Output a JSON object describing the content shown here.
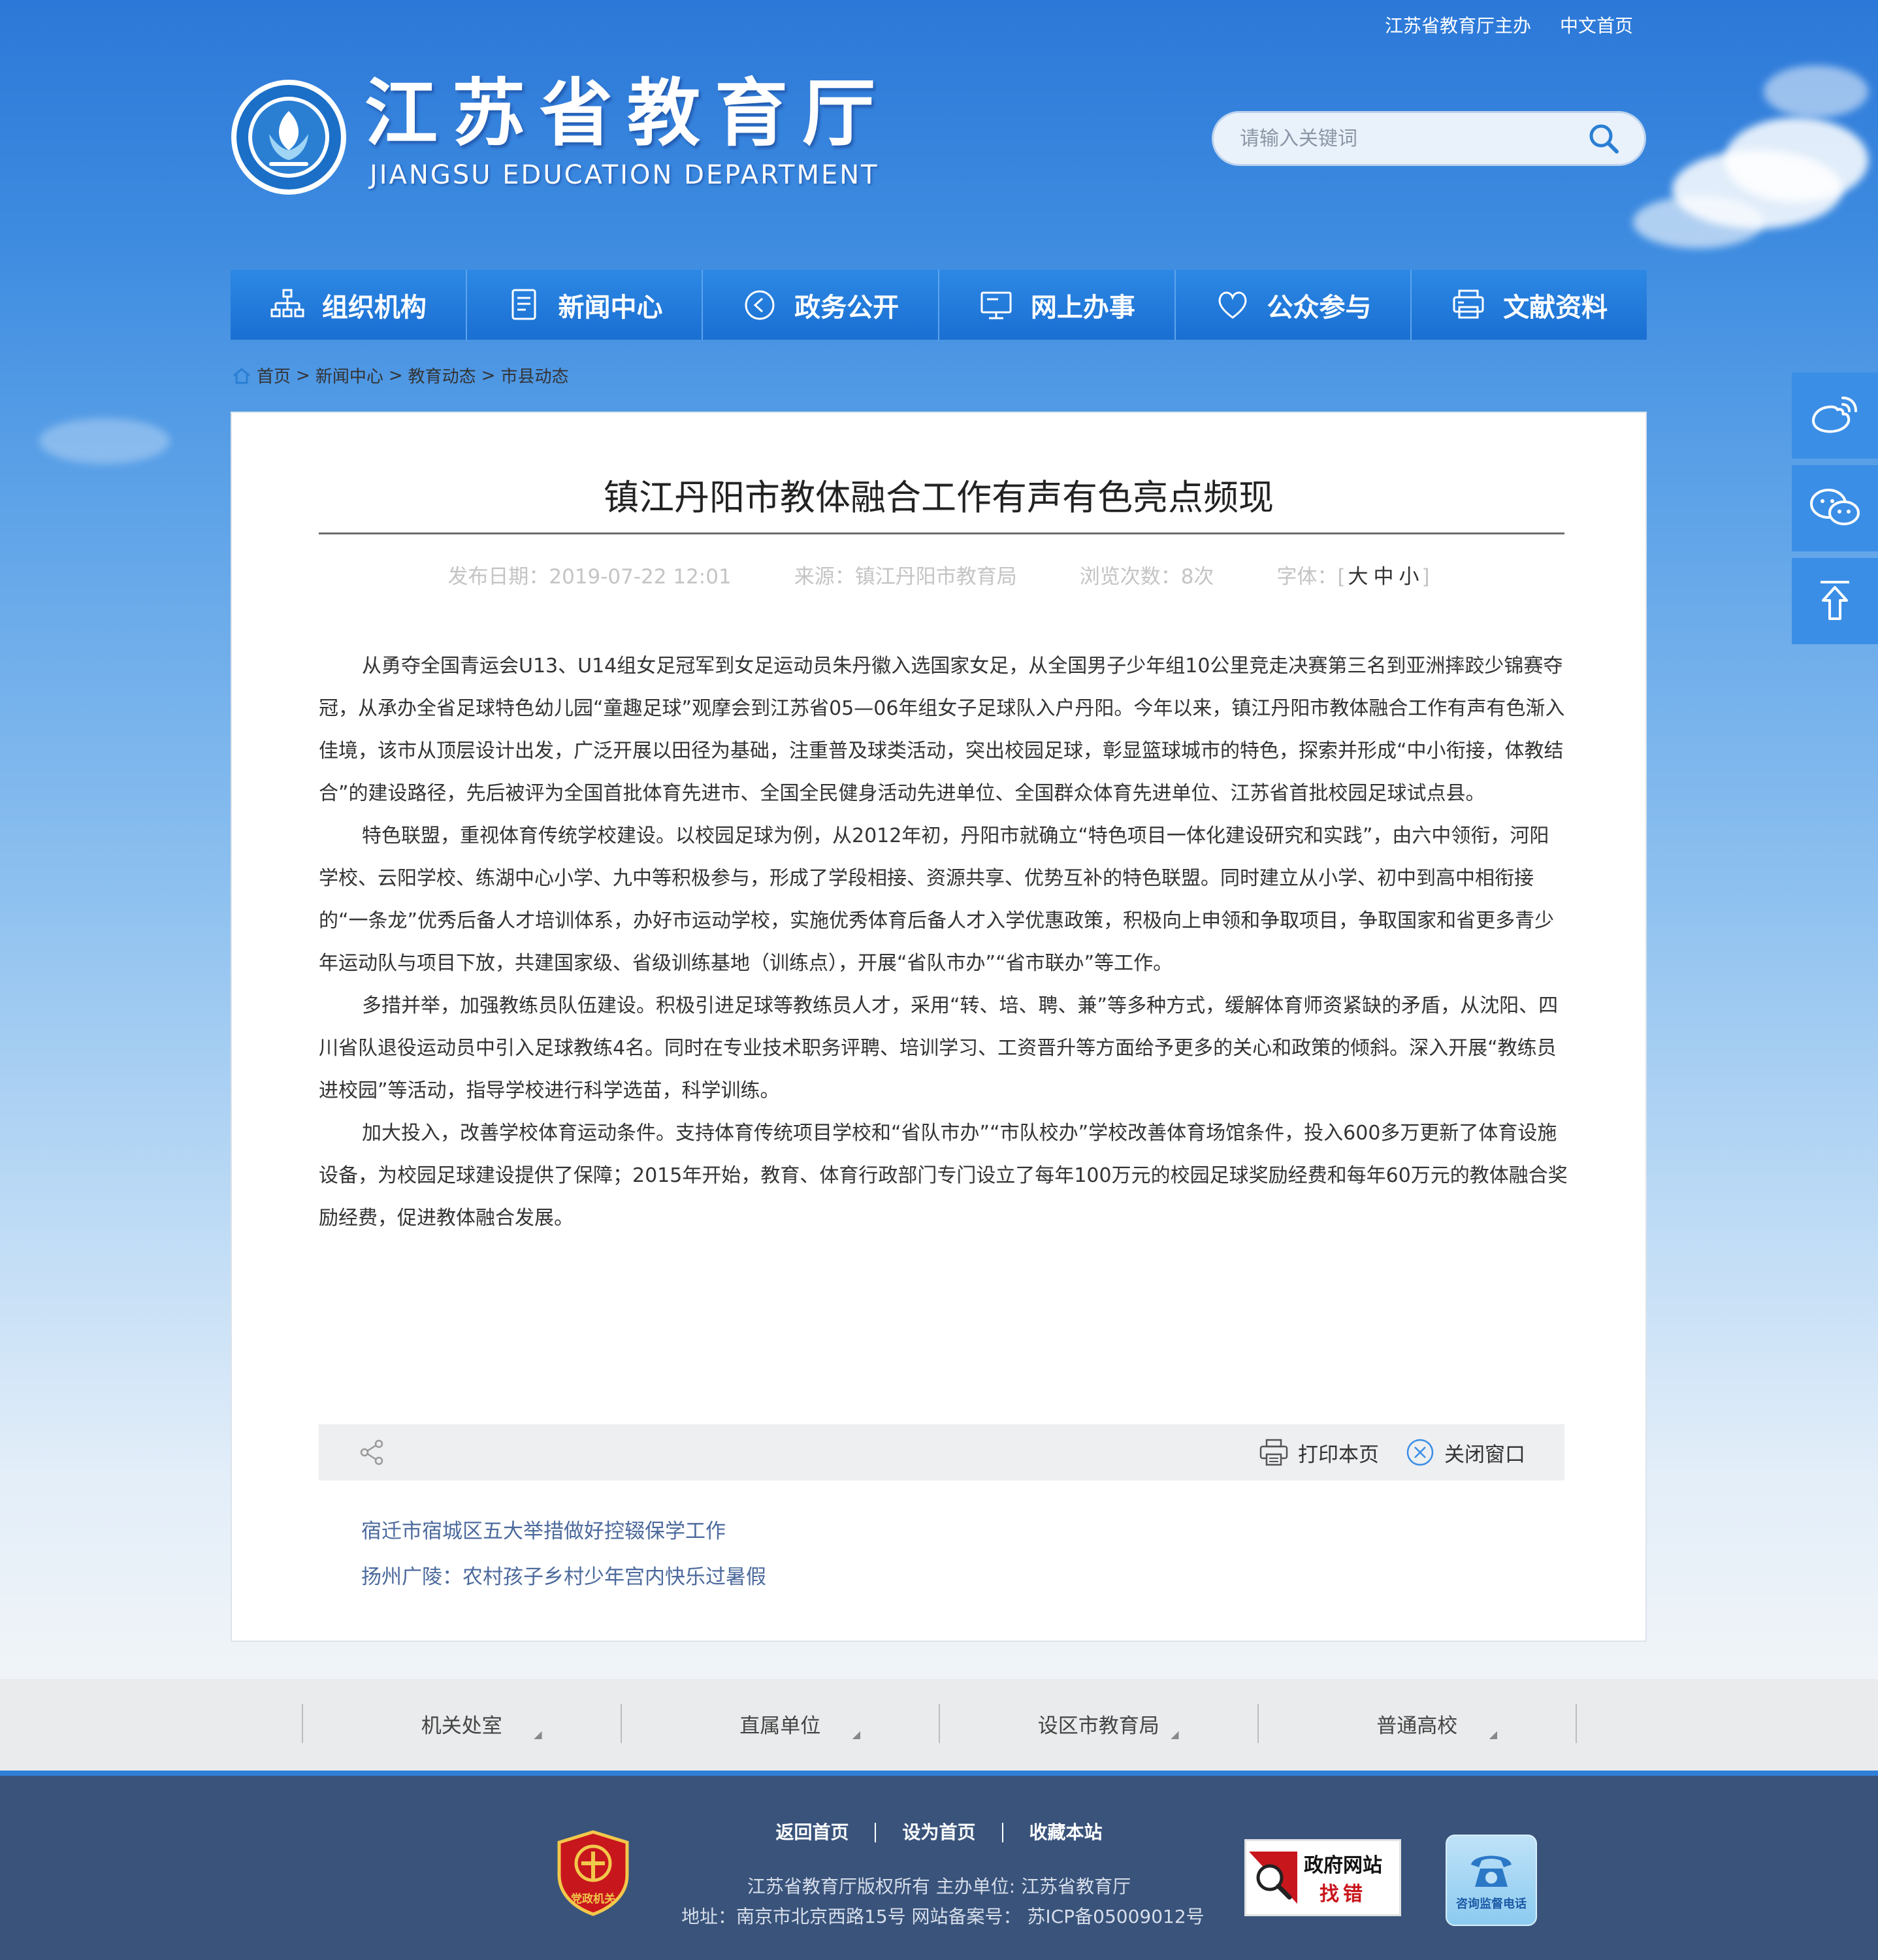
{
  "header": {
    "top_links": [
      "江苏省教育厅主办",
      "中文首页"
    ],
    "title_cn": "江苏省教育厅",
    "title_en": "JIANGSU EDUCATION DEPARTMENT",
    "search_placeholder": "请输入关键词"
  },
  "nav": {
    "items": [
      {
        "label": "组织机构",
        "icon": "org-chart-icon"
      },
      {
        "label": "新闻中心",
        "icon": "news-document-icon"
      },
      {
        "label": "政务公开",
        "icon": "play-circle-icon"
      },
      {
        "label": "网上办事",
        "icon": "monitor-icon"
      },
      {
        "label": "公众参与",
        "icon": "heart-icon"
      },
      {
        "label": "文献资料",
        "icon": "printer-stack-icon"
      }
    ]
  },
  "breadcrumb": {
    "items": [
      "首页",
      "新闻中心",
      "教育动态",
      "市县动态"
    ],
    "separator": ">"
  },
  "article": {
    "title": "镇江丹阳市教体融合工作有声有色亮点频现",
    "meta": {
      "date": "发布日期：2019-07-22 12:01",
      "source": "来源：镇江丹阳市教育局",
      "views": "浏览次数：8次",
      "font_label": "字体：[",
      "font_large": "大",
      "font_medium": "中",
      "font_small": "小",
      "font_close": "]"
    },
    "paragraphs": [
      "从勇夺全国青运会U13、U14组女足冠军到女足运动员朱丹徽入选国家女足，从全国男子少年组10公里竞走决赛第三名到亚洲摔跤少锦赛夺冠，从承办全省足球特色幼儿园“童趣足球”观摩会到江苏省05—06年组女子足球队入户丹阳。今年以来，镇江丹阳市教体融合工作有声有色渐入佳境，该市从顶层设计出发，广泛开展以田径为基础，注重普及球类活动，突出校园足球，彰显篮球城市的特色，探索并形成“中小衔接，体教结合”的建设路径，先后被评为全国首批体育先进市、全国全民健身活动先进单位、全国群众体育先进单位、江苏省首批校园足球试点县。",
      "特色联盟，重视体育传统学校建设。以校园足球为例，从2012年初，丹阳市就确立“特色项目一体化建设研究和实践”，由六中领衔，河阳学校、云阳学校、练湖中心小学、九中等积极参与，形成了学段相接、资源共享、优势互补的特色联盟。同时建立从小学、初中到高中相衔接的“一条龙”优秀后备人才培训体系，办好市运动学校，实施优秀体育后备人才入学优惠政策，积极向上申领和争取项目，争取国家和省更多青少年运动队与项目下放，共建国家级、省级训练基地（训练点），开展“省队市办”“省市联办”等工作。",
      "多措并举，加强教练员队伍建设。积极引进足球等教练员人才，采用“转、培、聘、兼”等多种方式，缓解体育师资紧缺的矛盾，从沈阳、四川省队退役运动员中引入足球教练4名。同时在专业技术职务评聘、培训学习、工资晋升等方面给予更多的关心和政策的倾斜。深入开展“教练员进校园”等活动，指导学校进行科学选苗，科学训练。",
      "加大投入，改善学校体育运动条件。支持体育传统项目学校和“省队市办”“市队校办”学校改善体育场馆条件，投入600多万更新了体育设施设备，为校园足球建设提供了保障；2015年开始，教育、体育行政部门专门设立了每年100万元的校园足球奖励经费和每年60万元的教体融合奖励经费，促进教体融合发展。"
    ],
    "toolbar": {
      "print": "打印本页",
      "close": "关闭窗口"
    },
    "related": [
      "宿迁市宿城区五大举措做好控辍保学工作",
      "扬州广陵：农村孩子乡村少年宫内快乐过暑假"
    ]
  },
  "link_band": {
    "items": [
      "机关处室",
      "直属单位",
      "设区市教育局",
      "普通高校"
    ]
  },
  "footer": {
    "links": [
      "返回首页",
      "设为首页",
      "收藏本站"
    ],
    "copyright": "江苏省教育厅版权所有 主办单位: 江苏省教育厅",
    "address": "地址：南京市北京西路15号 网站备案号： 苏ICP备05009012号",
    "party_badge": "党政机关",
    "gov_badge_line1": "政府网站",
    "gov_badge_line2": "找错",
    "tel_badge": "咨询监督电话"
  },
  "colors": {
    "nav_blue": "#1a6fd2",
    "footer_bg": "#39537b",
    "link_color": "#4c6a9c",
    "float_bar": "#3a8ee6"
  }
}
